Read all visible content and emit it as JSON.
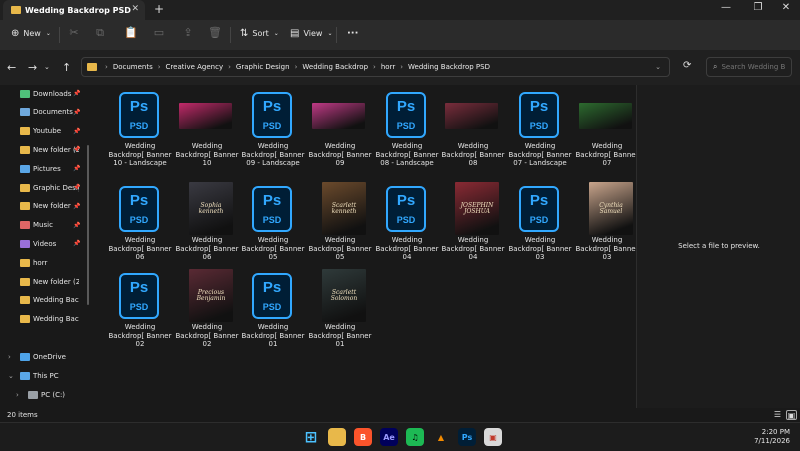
{
  "window": {
    "tab_title": "Wedding Backdrop PSD",
    "new_tab": "+",
    "minimize": "—",
    "maximize": "❐",
    "close": "✕"
  },
  "toolbar": {
    "new_label": "New",
    "sort_label": "Sort",
    "view_label": "View",
    "more_label": "···"
  },
  "address": {
    "breadcrumbs": [
      "Documents",
      "Creative Agency",
      "Graphic Design",
      "Wedding Backdrop",
      "horr",
      "Wedding Backdrop PSD"
    ],
    "search_placeholder": "Search Wedding B..."
  },
  "sidebar": {
    "quick_access": [
      {
        "label": "Downloads",
        "icon": "download-icon",
        "color": "#4fc17a",
        "pinned": true
      },
      {
        "label": "Documents",
        "icon": "documents-icon",
        "color": "#6fa8dc",
        "pinned": true
      },
      {
        "label": "Youtube",
        "icon": "folder-icon",
        "color": "#e8b84a",
        "pinned": true
      },
      {
        "label": "New folder (2)",
        "icon": "folder-icon",
        "color": "#e8b84a",
        "pinned": true
      },
      {
        "label": "Pictures",
        "icon": "pictures-icon",
        "color": "#5aa6e6",
        "pinned": true
      },
      {
        "label": "Graphic Design",
        "icon": "folder-icon",
        "color": "#e8b84a",
        "pinned": true
      },
      {
        "label": "New folder",
        "icon": "folder-icon",
        "color": "#e8b84a",
        "pinned": true
      },
      {
        "label": "Music",
        "icon": "music-icon",
        "color": "#e06666",
        "pinned": true
      },
      {
        "label": "Videos",
        "icon": "videos-icon",
        "color": "#9a6fd8",
        "pinned": true
      },
      {
        "label": "horr",
        "icon": "folder-icon",
        "color": "#e8b84a",
        "pinned": false
      },
      {
        "label": "New folder (2)",
        "icon": "folder-icon",
        "color": "#e8b84a",
        "pinned": false
      },
      {
        "label": "Wedding Backdrop",
        "icon": "folder-icon",
        "color": "#e8b84a",
        "pinned": false
      },
      {
        "label": "Wedding Backdrop",
        "icon": "folder-icon",
        "color": "#e8b84a",
        "pinned": false
      }
    ],
    "onedrive": "OneDrive",
    "this_pc": "This PC",
    "pc_drive": "PC (C:)"
  },
  "files": [
    {
      "name": "Wedding Backdrop[ Banner 10 - Landscape",
      "kind": "psd"
    },
    {
      "name": "Wedding Backdrop[ Banner 10",
      "kind": "jpg",
      "shape": "land",
      "color": "#c22a6a"
    },
    {
      "name": "Wedding Backdrop[ Banner 09 - Landscape",
      "kind": "psd"
    },
    {
      "name": "Wedding Backdrop[ Banner 09",
      "kind": "jpg",
      "shape": "land",
      "color": "#c03a86"
    },
    {
      "name": "Wedding Backdrop[ Banner 08 - Landscape",
      "kind": "psd"
    },
    {
      "name": "Wedding Backdrop[ Banner 08",
      "kind": "jpg",
      "shape": "land",
      "color": "#7a2d3c"
    },
    {
      "name": "Wedding Backdrop[ Banner 07 - Landscape",
      "kind": "psd"
    },
    {
      "name": "Wedding Backdrop[ Banner 07",
      "kind": "jpg",
      "shape": "land",
      "color": "#2d6b2f"
    },
    {
      "name": "Wedding Backdrop[ Banner 06",
      "kind": "psd"
    },
    {
      "name": "Wedding Backdrop[ Banner 06",
      "kind": "jpg",
      "shape": "port",
      "color": "#3a3a42",
      "text": "Sophia kenneth"
    },
    {
      "name": "Wedding Backdrop[ Banner 05",
      "kind": "psd"
    },
    {
      "name": "Wedding Backdrop[ Banner 05",
      "kind": "jpg",
      "shape": "port",
      "color": "#6b4a2c",
      "text": "Scarlett kenneth"
    },
    {
      "name": "Wedding Backdrop[ Banner 04",
      "kind": "psd"
    },
    {
      "name": "Wedding Backdrop[ Banner 04",
      "kind": "jpg",
      "shape": "port",
      "color": "#8a2a34",
      "text": "JOSEPHIN JOSHUA"
    },
    {
      "name": "Wedding Backdrop[ Banner 03",
      "kind": "psd"
    },
    {
      "name": "Wedding Backdrop[ Banner 03",
      "kind": "jpg",
      "shape": "port",
      "color": "#c9a58c",
      "text": "Cynthia Samuel"
    },
    {
      "name": "Wedding Backdrop[ Banner 02",
      "kind": "psd"
    },
    {
      "name": "Wedding Backdrop[ Banner 02",
      "kind": "jpg",
      "shape": "port",
      "color": "#5a2a34",
      "text": "Precious Benjamin"
    },
    {
      "name": "Wedding Backdrop[ Banner 01",
      "kind": "psd"
    },
    {
      "name": "Wedding Backdrop[ Banner 01",
      "kind": "jpg",
      "shape": "port",
      "color": "#2f3a3a",
      "text": "Scarlett Solomon"
    }
  ],
  "psd_icon": {
    "ps": "Ps",
    "label": "PSD"
  },
  "preview": {
    "text": "Select a file to preview."
  },
  "status": {
    "count": "20 items"
  },
  "taskbar": {
    "apps": [
      {
        "name": "windows-start",
        "glyph": "⊞",
        "bg": "transparent",
        "fg": "#4cc2ff"
      },
      {
        "name": "file-explorer",
        "glyph": "",
        "bg": "#e8b84a",
        "fg": "#000"
      },
      {
        "name": "brave",
        "glyph": "B",
        "bg": "#fb542b",
        "fg": "#fff"
      },
      {
        "name": "after-effects",
        "glyph": "Ae",
        "bg": "#00005b",
        "fg": "#9999ff"
      },
      {
        "name": "spotify",
        "glyph": "♫",
        "bg": "#1db954",
        "fg": "#000"
      },
      {
        "name": "vlc",
        "glyph": "▲",
        "bg": "transparent",
        "fg": "#f48b00"
      },
      {
        "name": "photoshop",
        "glyph": "Ps",
        "bg": "#001e36",
        "fg": "#31a8ff"
      },
      {
        "name": "image-viewer",
        "glyph": "▣",
        "bg": "#d9d9d9",
        "fg": "#c0392b"
      }
    ],
    "time": "2:20 PM",
    "date": "7/11/2026"
  }
}
